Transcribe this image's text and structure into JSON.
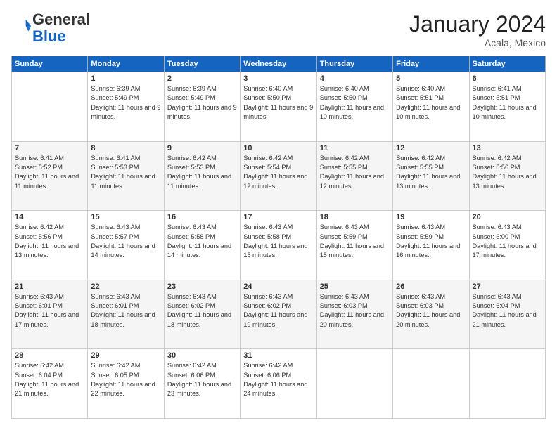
{
  "header": {
    "logo_line1": "General",
    "logo_line2": "Blue",
    "month_title": "January 2024",
    "location": "Acala, Mexico"
  },
  "weekdays": [
    "Sunday",
    "Monday",
    "Tuesday",
    "Wednesday",
    "Thursday",
    "Friday",
    "Saturday"
  ],
  "weeks": [
    [
      {
        "day": "",
        "sunrise": "",
        "sunset": "",
        "daylight": ""
      },
      {
        "day": "1",
        "sunrise": "Sunrise: 6:39 AM",
        "sunset": "Sunset: 5:49 PM",
        "daylight": "Daylight: 11 hours and 9 minutes."
      },
      {
        "day": "2",
        "sunrise": "Sunrise: 6:39 AM",
        "sunset": "Sunset: 5:49 PM",
        "daylight": "Daylight: 11 hours and 9 minutes."
      },
      {
        "day": "3",
        "sunrise": "Sunrise: 6:40 AM",
        "sunset": "Sunset: 5:50 PM",
        "daylight": "Daylight: 11 hours and 9 minutes."
      },
      {
        "day": "4",
        "sunrise": "Sunrise: 6:40 AM",
        "sunset": "Sunset: 5:50 PM",
        "daylight": "Daylight: 11 hours and 10 minutes."
      },
      {
        "day": "5",
        "sunrise": "Sunrise: 6:40 AM",
        "sunset": "Sunset: 5:51 PM",
        "daylight": "Daylight: 11 hours and 10 minutes."
      },
      {
        "day": "6",
        "sunrise": "Sunrise: 6:41 AM",
        "sunset": "Sunset: 5:51 PM",
        "daylight": "Daylight: 11 hours and 10 minutes."
      }
    ],
    [
      {
        "day": "7",
        "sunrise": "Sunrise: 6:41 AM",
        "sunset": "Sunset: 5:52 PM",
        "daylight": "Daylight: 11 hours and 11 minutes."
      },
      {
        "day": "8",
        "sunrise": "Sunrise: 6:41 AM",
        "sunset": "Sunset: 5:53 PM",
        "daylight": "Daylight: 11 hours and 11 minutes."
      },
      {
        "day": "9",
        "sunrise": "Sunrise: 6:42 AM",
        "sunset": "Sunset: 5:53 PM",
        "daylight": "Daylight: 11 hours and 11 minutes."
      },
      {
        "day": "10",
        "sunrise": "Sunrise: 6:42 AM",
        "sunset": "Sunset: 5:54 PM",
        "daylight": "Daylight: 11 hours and 12 minutes."
      },
      {
        "day": "11",
        "sunrise": "Sunrise: 6:42 AM",
        "sunset": "Sunset: 5:55 PM",
        "daylight": "Daylight: 11 hours and 12 minutes."
      },
      {
        "day": "12",
        "sunrise": "Sunrise: 6:42 AM",
        "sunset": "Sunset: 5:55 PM",
        "daylight": "Daylight: 11 hours and 13 minutes."
      },
      {
        "day": "13",
        "sunrise": "Sunrise: 6:42 AM",
        "sunset": "Sunset: 5:56 PM",
        "daylight": "Daylight: 11 hours and 13 minutes."
      }
    ],
    [
      {
        "day": "14",
        "sunrise": "Sunrise: 6:42 AM",
        "sunset": "Sunset: 5:56 PM",
        "daylight": "Daylight: 11 hours and 13 minutes."
      },
      {
        "day": "15",
        "sunrise": "Sunrise: 6:43 AM",
        "sunset": "Sunset: 5:57 PM",
        "daylight": "Daylight: 11 hours and 14 minutes."
      },
      {
        "day": "16",
        "sunrise": "Sunrise: 6:43 AM",
        "sunset": "Sunset: 5:58 PM",
        "daylight": "Daylight: 11 hours and 14 minutes."
      },
      {
        "day": "17",
        "sunrise": "Sunrise: 6:43 AM",
        "sunset": "Sunset: 5:58 PM",
        "daylight": "Daylight: 11 hours and 15 minutes."
      },
      {
        "day": "18",
        "sunrise": "Sunrise: 6:43 AM",
        "sunset": "Sunset: 5:59 PM",
        "daylight": "Daylight: 11 hours and 15 minutes."
      },
      {
        "day": "19",
        "sunrise": "Sunrise: 6:43 AM",
        "sunset": "Sunset: 5:59 PM",
        "daylight": "Daylight: 11 hours and 16 minutes."
      },
      {
        "day": "20",
        "sunrise": "Sunrise: 6:43 AM",
        "sunset": "Sunset: 6:00 PM",
        "daylight": "Daylight: 11 hours and 17 minutes."
      }
    ],
    [
      {
        "day": "21",
        "sunrise": "Sunrise: 6:43 AM",
        "sunset": "Sunset: 6:01 PM",
        "daylight": "Daylight: 11 hours and 17 minutes."
      },
      {
        "day": "22",
        "sunrise": "Sunrise: 6:43 AM",
        "sunset": "Sunset: 6:01 PM",
        "daylight": "Daylight: 11 hours and 18 minutes."
      },
      {
        "day": "23",
        "sunrise": "Sunrise: 6:43 AM",
        "sunset": "Sunset: 6:02 PM",
        "daylight": "Daylight: 11 hours and 18 minutes."
      },
      {
        "day": "24",
        "sunrise": "Sunrise: 6:43 AM",
        "sunset": "Sunset: 6:02 PM",
        "daylight": "Daylight: 11 hours and 19 minutes."
      },
      {
        "day": "25",
        "sunrise": "Sunrise: 6:43 AM",
        "sunset": "Sunset: 6:03 PM",
        "daylight": "Daylight: 11 hours and 20 minutes."
      },
      {
        "day": "26",
        "sunrise": "Sunrise: 6:43 AM",
        "sunset": "Sunset: 6:03 PM",
        "daylight": "Daylight: 11 hours and 20 minutes."
      },
      {
        "day": "27",
        "sunrise": "Sunrise: 6:43 AM",
        "sunset": "Sunset: 6:04 PM",
        "daylight": "Daylight: 11 hours and 21 minutes."
      }
    ],
    [
      {
        "day": "28",
        "sunrise": "Sunrise: 6:42 AM",
        "sunset": "Sunset: 6:04 PM",
        "daylight": "Daylight: 11 hours and 21 minutes."
      },
      {
        "day": "29",
        "sunrise": "Sunrise: 6:42 AM",
        "sunset": "Sunset: 6:05 PM",
        "daylight": "Daylight: 11 hours and 22 minutes."
      },
      {
        "day": "30",
        "sunrise": "Sunrise: 6:42 AM",
        "sunset": "Sunset: 6:06 PM",
        "daylight": "Daylight: 11 hours and 23 minutes."
      },
      {
        "day": "31",
        "sunrise": "Sunrise: 6:42 AM",
        "sunset": "Sunset: 6:06 PM",
        "daylight": "Daylight: 11 hours and 24 minutes."
      },
      {
        "day": "",
        "sunrise": "",
        "sunset": "",
        "daylight": ""
      },
      {
        "day": "",
        "sunrise": "",
        "sunset": "",
        "daylight": ""
      },
      {
        "day": "",
        "sunrise": "",
        "sunset": "",
        "daylight": ""
      }
    ]
  ]
}
